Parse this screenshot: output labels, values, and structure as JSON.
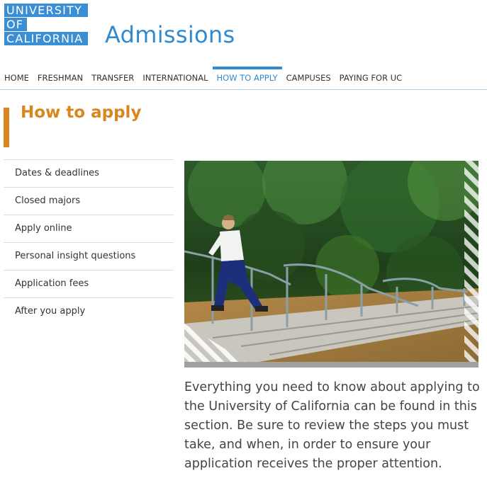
{
  "header": {
    "logo_lines": [
      "UNIVERSITY",
      "OF",
      "CALIFORNIA"
    ],
    "site_title": "Admissions"
  },
  "nav": {
    "items": [
      {
        "label": "HOME"
      },
      {
        "label": "FRESHMAN"
      },
      {
        "label": "TRANSFER"
      },
      {
        "label": "INTERNATIONAL"
      },
      {
        "label": "HOW TO APPLY",
        "active": true
      },
      {
        "label": "CAMPUSES"
      },
      {
        "label": "PAYING FOR UC"
      }
    ]
  },
  "page": {
    "title": "How to apply"
  },
  "sidemenu": {
    "items": [
      {
        "label": "Dates & deadlines"
      },
      {
        "label": "Closed majors"
      },
      {
        "label": "Apply online"
      },
      {
        "label": "Personal insight questions"
      },
      {
        "label": "Application fees"
      },
      {
        "label": "After you apply"
      }
    ]
  },
  "main": {
    "intro": "Everything you need to know about applying to the University of California can be found in this section. Be sure to review the steps you must take, and when, in order to ensure your application receives the proper attention."
  },
  "colors": {
    "brand_blue": "#2f8ad0",
    "accent_orange": "#d9861f"
  }
}
